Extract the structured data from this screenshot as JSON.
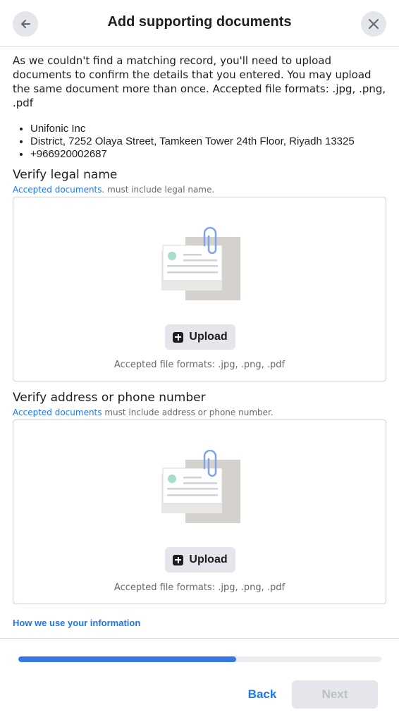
{
  "header": {
    "title": "Add supporting documents",
    "back_icon": "arrow-left-icon",
    "close_icon": "close-icon"
  },
  "intro": "As we couldn't find a matching record, you'll need to upload documents to confirm the details that you entered. You may upload the same document more than once. Accepted file formats: .jpg, .png, .pdf",
  "record": [
    "Unifonic Inc",
    "District, 7252 Olaya Street, Tamkeen Tower 24th Floor, Riyadh 13325",
    "+966920002687"
  ],
  "sections": [
    {
      "title": "Verify legal name",
      "hint_link": "Accepted documents",
      "hint_rest": ". must include legal name.",
      "upload_label": "Upload",
      "formats": "Accepted file formats: .jpg, .png, .pdf"
    },
    {
      "title": "Verify address or phone number",
      "hint_link": "Accepted documents",
      "hint_rest": " must include address or phone number.",
      "upload_label": "Upload",
      "formats": "Accepted file formats: .jpg, .png, .pdf"
    }
  ],
  "how_link": "How we use your information",
  "progress": {
    "fraction": 0.6
  },
  "footer": {
    "back_label": "Back",
    "next_label": "Next"
  },
  "colors": {
    "accent": "#1877f2",
    "progress_fill": "#3578e5",
    "disabled_text": "#bcc0c4"
  }
}
